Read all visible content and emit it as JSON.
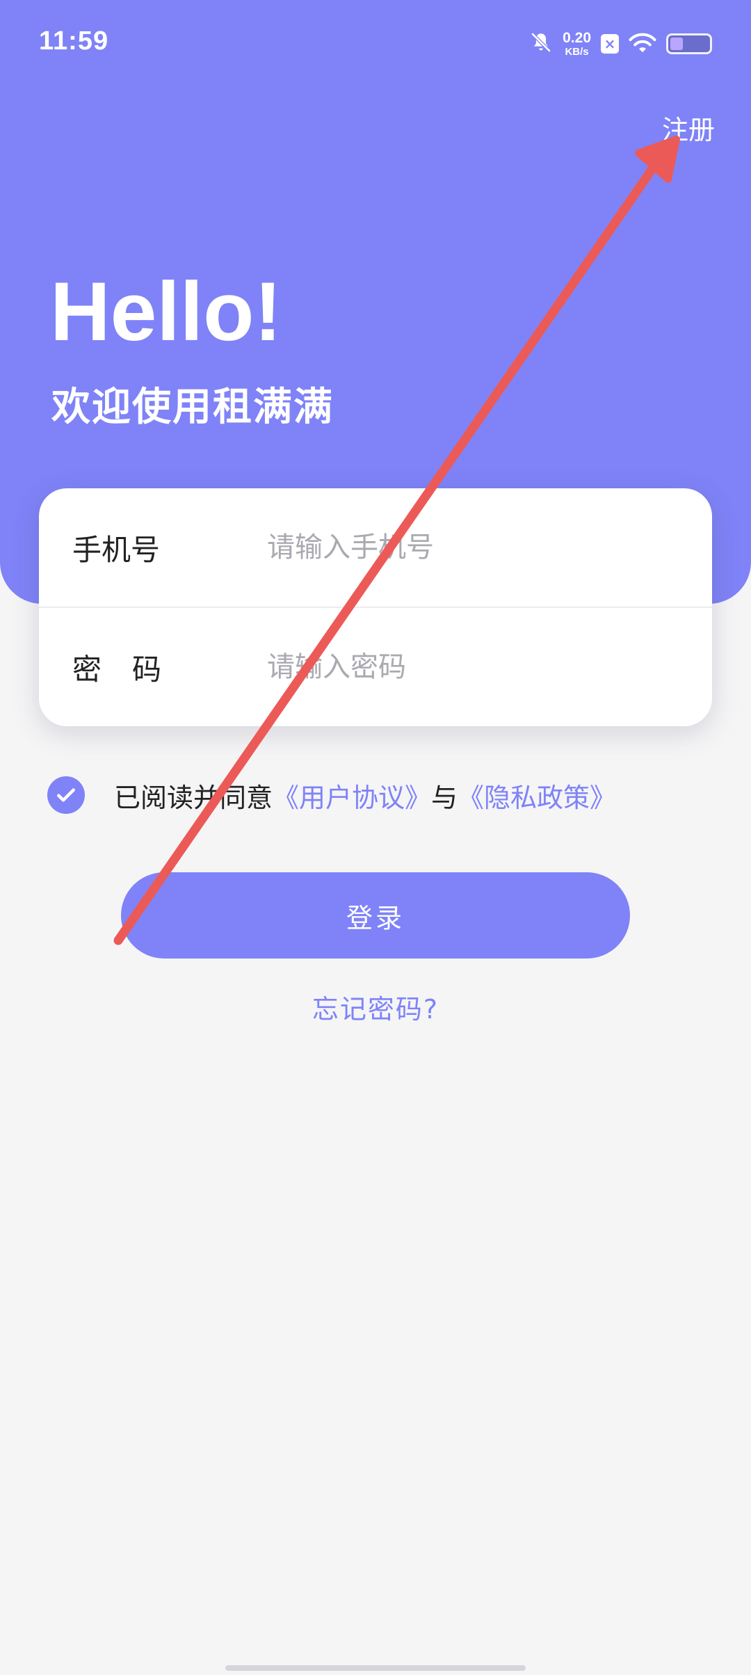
{
  "status_bar": {
    "time": "11:59",
    "net_speed_value": "0.20",
    "net_speed_unit": "KB/s",
    "sim_label": "×",
    "icons": [
      "mute-bell-icon",
      "sim-icon",
      "wifi-icon",
      "battery-icon"
    ]
  },
  "header": {
    "register_label": "注册",
    "hello": "Hello!",
    "welcome": "欢迎使用租满满"
  },
  "form": {
    "phone_label": "手机号",
    "phone_placeholder": "请输入手机号",
    "phone_value": "",
    "password_label": "密码",
    "password_placeholder": "请输入密码",
    "password_value": ""
  },
  "agreement": {
    "checked": true,
    "prefix": "已阅读并同意",
    "user_agreement": "《用户协议》",
    "conjunction": "与",
    "privacy_policy": "《隐私政策》"
  },
  "actions": {
    "login_label": "登录",
    "forgot_label": "忘记密码?"
  },
  "colors": {
    "accent": "#7f83f7",
    "background": "#f5f5f6",
    "annotation_arrow": "#ec5a57"
  }
}
